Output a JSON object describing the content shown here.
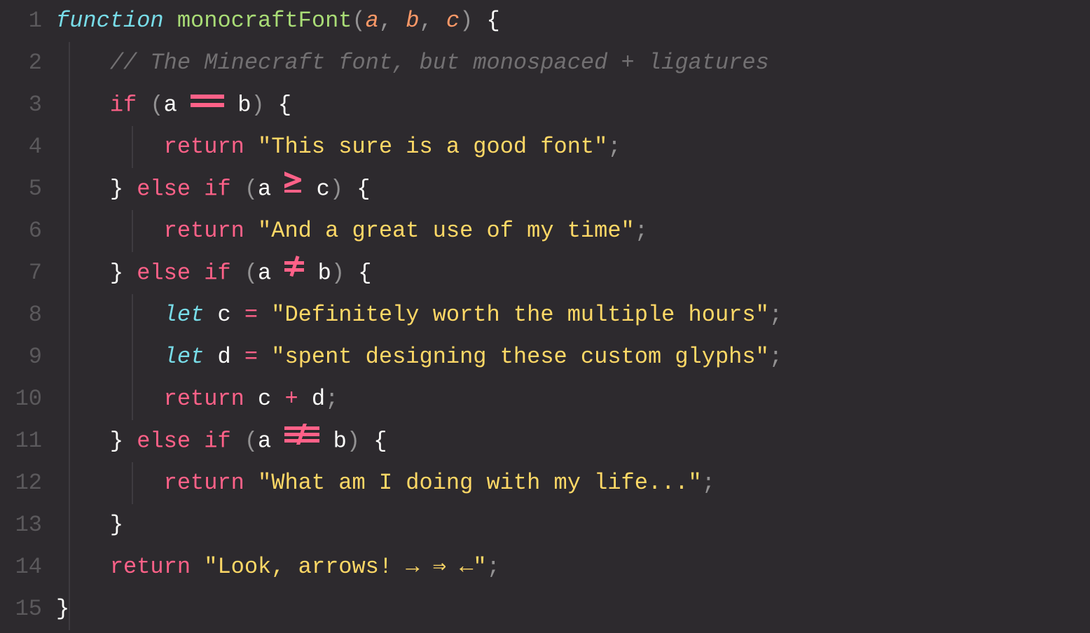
{
  "line_numbers": [
    "1",
    "2",
    "3",
    "4",
    "5",
    "6",
    "7",
    "8",
    "9",
    "10",
    "11",
    "12",
    "13",
    "14",
    "15"
  ],
  "tokens": {
    "function": "function",
    "fn_name": "monocraftFont",
    "params": {
      "a": "a",
      "b": "b",
      "c": "c"
    },
    "comment": "// The Minecraft font, but monospaced + ligatures",
    "if": "if",
    "else": "else",
    "return": "return",
    "let": "let",
    "var_a": "a",
    "var_b": "b",
    "var_c": "c",
    "var_d": "d",
    "op_eq": "==",
    "op_gte": ">=",
    "op_neq": "!=",
    "op_neqq": "!==",
    "op_assign": "=",
    "op_plus": "+"
  },
  "strings": {
    "s1": "\"This sure is a good font\"",
    "s2": "\"And a great use of my time\"",
    "s3": "\"Definitely worth the multiple hours\"",
    "s4": "\"spent designing these custom glyphs\"",
    "s5": "\"What am I doing with my life...\"",
    "s6": "\"Look, arrows! → ⇒ ←\""
  }
}
